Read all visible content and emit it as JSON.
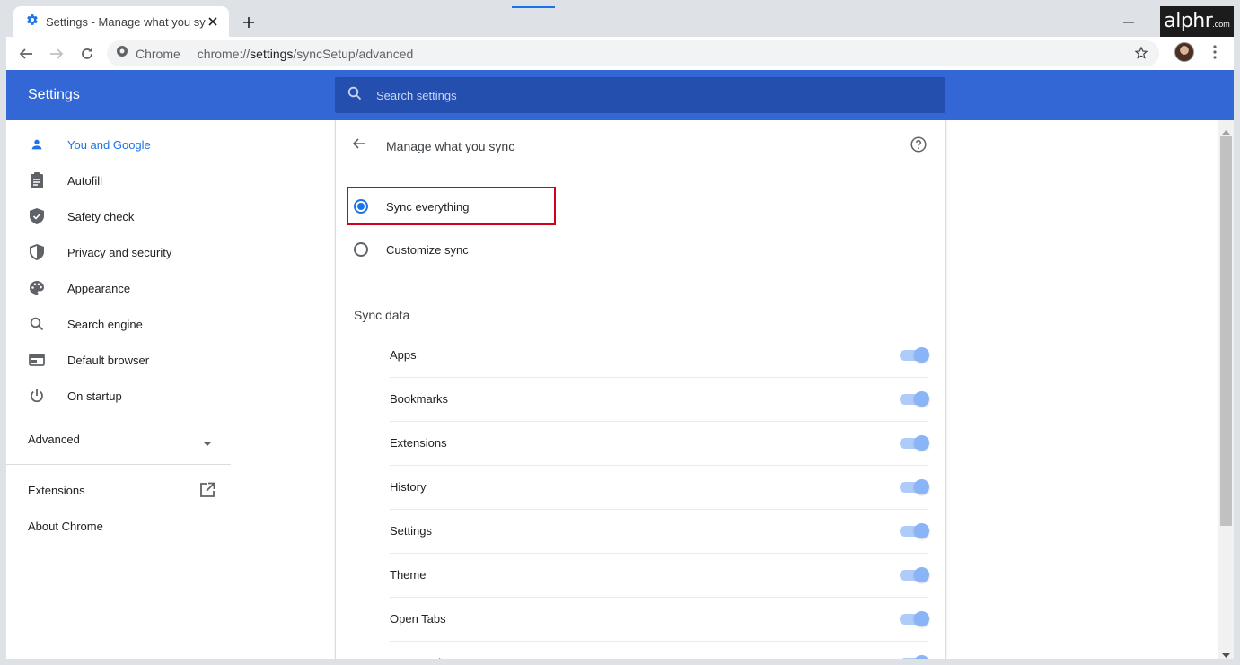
{
  "browser": {
    "tab_title": "Settings - Manage what you sync",
    "site_name": "Chrome",
    "url_prefix": "chrome://",
    "url_host": "settings",
    "url_path": "/syncSetup/advanced",
    "watermark_main": "alphr",
    "watermark_suffix": ".com"
  },
  "header": {
    "title": "Settings",
    "search_placeholder": "Search settings"
  },
  "sidebar": {
    "items": [
      {
        "label": "You and Google",
        "icon": "person-icon",
        "active": true
      },
      {
        "label": "Autofill",
        "icon": "clipboard-icon"
      },
      {
        "label": "Safety check",
        "icon": "shield-check-icon"
      },
      {
        "label": "Privacy and security",
        "icon": "shield-half-icon"
      },
      {
        "label": "Appearance",
        "icon": "palette-icon"
      },
      {
        "label": "Search engine",
        "icon": "search-icon"
      },
      {
        "label": "Default browser",
        "icon": "browser-window-icon"
      },
      {
        "label": "On startup",
        "icon": "power-icon"
      }
    ],
    "advanced": "Advanced",
    "extensions": "Extensions",
    "about": "About Chrome"
  },
  "main": {
    "title": "Manage what you sync",
    "options": {
      "sync_everything": "Sync everything",
      "customize_sync": "Customize sync",
      "selected": "Sync everything"
    },
    "section_title": "Sync data",
    "sync_items": [
      {
        "label": "Apps",
        "enabled": true
      },
      {
        "label": "Bookmarks",
        "enabled": true
      },
      {
        "label": "Extensions",
        "enabled": true
      },
      {
        "label": "History",
        "enabled": true
      },
      {
        "label": "Settings",
        "enabled": true
      },
      {
        "label": "Theme",
        "enabled": true
      },
      {
        "label": "Open Tabs",
        "enabled": true
      },
      {
        "label": "Passwords",
        "enabled": true
      }
    ]
  },
  "colors": {
    "header": "#3367d6",
    "accent": "#1a73e8",
    "highlight": "#d0021b"
  }
}
